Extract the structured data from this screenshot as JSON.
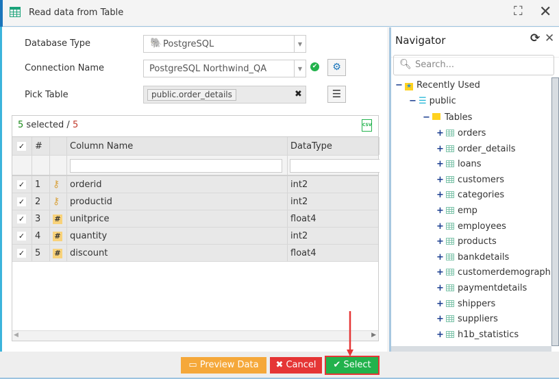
{
  "window": {
    "title": "Read data from Table"
  },
  "form": {
    "db_type_label": "Database Type",
    "db_type_value": "PostgreSQL",
    "conn_label": "Connection Name",
    "conn_value": "PostgreSQL Northwind_QA",
    "pick_label": "Pick Table",
    "pick_value": "public.order_details"
  },
  "grid": {
    "selected_count": "5",
    "selected_text": "selected /",
    "total": "5",
    "headers": {
      "num": "#",
      "name": "Column Name",
      "type": "DataType"
    },
    "rows": [
      {
        "n": "1",
        "icon": "key",
        "name": "orderid",
        "type": "int2"
      },
      {
        "n": "2",
        "icon": "key",
        "name": "productid",
        "type": "int2"
      },
      {
        "n": "3",
        "icon": "hash",
        "name": "unitprice",
        "type": "float4"
      },
      {
        "n": "4",
        "icon": "hash",
        "name": "quantity",
        "type": "int2"
      },
      {
        "n": "5",
        "icon": "hash",
        "name": "discount",
        "type": "float4"
      }
    ]
  },
  "navigator": {
    "title": "Navigator",
    "search_placeholder": "Search...",
    "recent": "Recently Used",
    "schema": "public",
    "folder": "Tables",
    "tables": [
      "orders",
      "order_details",
      "loans",
      "customers",
      "categories",
      "emp",
      "employees",
      "products",
      "bankdetails",
      "customerdemographi",
      "paymentdetails",
      "shippers",
      "suppliers",
      "h1b_statistics"
    ]
  },
  "footer": {
    "preview": "Preview Data",
    "cancel": "Cancel",
    "select": "Select"
  },
  "colors": {
    "accent": "#1b75bb",
    "preview": "#f5a83a",
    "cancel": "#e53535",
    "select": "#22b24c"
  }
}
